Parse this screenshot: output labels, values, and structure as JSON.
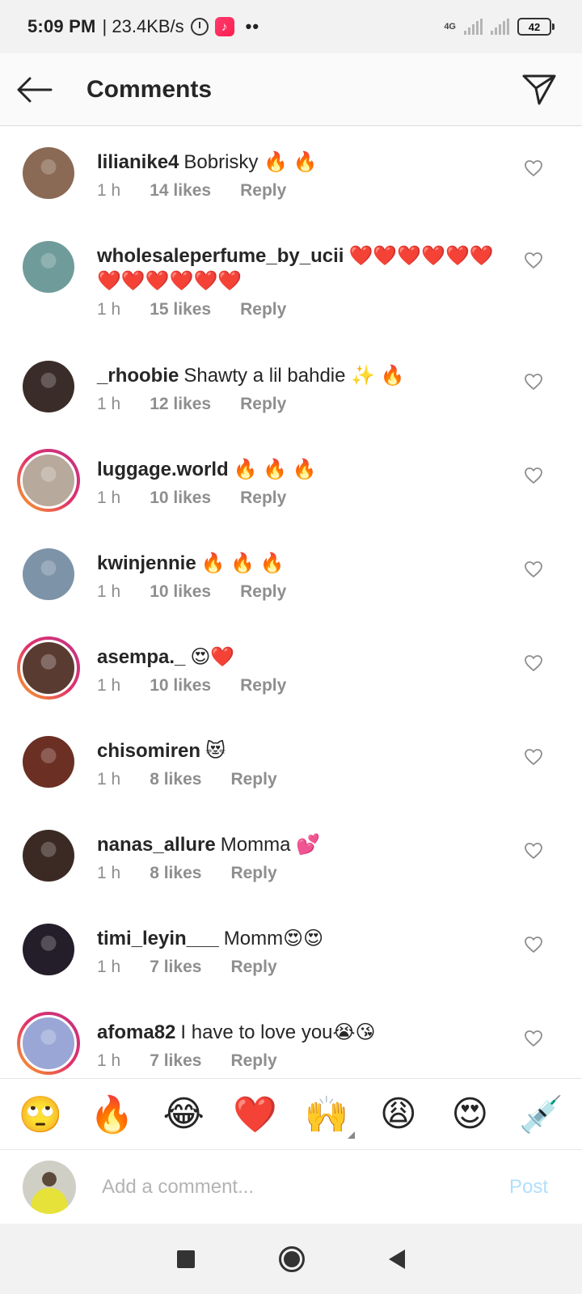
{
  "status_bar": {
    "time": "5:09 PM",
    "speed": "| 23.4KB/s",
    "dots": "••",
    "network": "4G",
    "battery": "42"
  },
  "header": {
    "title": "Comments"
  },
  "comments": [
    {
      "username": "lilianike4",
      "text": "Bobrisky 🔥 🔥",
      "time": "1 h",
      "likes": "14 likes",
      "reply": "Reply",
      "avatar_color": "#8a6a55",
      "story": false
    },
    {
      "username": "wholesaleperfume_by_ucii",
      "text": "❤️❤️❤️❤️❤️❤️❤️❤️❤️❤️❤️❤️",
      "time": "1 h",
      "likes": "15 likes",
      "reply": "Reply",
      "avatar_color": "#6f9c9a",
      "story": false
    },
    {
      "username": "_rhoobie",
      "text": "Shawty a lil bahdie ✨ 🔥",
      "time": "1 h",
      "likes": "12 likes",
      "reply": "Reply",
      "avatar_color": "#3a2c28",
      "story": false
    },
    {
      "username": "luggage.world",
      "text": "🔥 🔥 🔥",
      "time": "1 h",
      "likes": "10 likes",
      "reply": "Reply",
      "avatar_color": "#b7a99b",
      "story": true
    },
    {
      "username": "kwinjennie",
      "text": "🔥 🔥 🔥",
      "time": "1 h",
      "likes": "10 likes",
      "reply": "Reply",
      "avatar_color": "#7d93a8",
      "story": false
    },
    {
      "username": "asempa._",
      "text": "😍❤️",
      "time": "1 h",
      "likes": "10 likes",
      "reply": "Reply",
      "avatar_color": "#5a3b32",
      "story": true
    },
    {
      "username": "chisomiren",
      "text": "😻",
      "time": "1 h",
      "likes": "8 likes",
      "reply": "Reply",
      "avatar_color": "#6b2f24",
      "story": false
    },
    {
      "username": "nanas_allure",
      "text": "Momma 💕",
      "time": "1 h",
      "likes": "8 likes",
      "reply": "Reply",
      "avatar_color": "#3b2a24",
      "story": false
    },
    {
      "username": "timi_leyin___",
      "text": "Momm😍😍",
      "time": "1 h",
      "likes": "7 likes",
      "reply": "Reply",
      "avatar_color": "#241d2a",
      "story": false
    },
    {
      "username": "afoma82",
      "text": "I have to love you😭😘",
      "time": "1 h",
      "likes": "7 likes",
      "reply": "Reply",
      "avatar_color": "#9aa7d6",
      "story": true
    }
  ],
  "emoji_bar": [
    "🙄",
    "🔥",
    "😂",
    "❤️",
    "🙌",
    "😩",
    "😍",
    "💉"
  ],
  "comment_input": {
    "placeholder": "Add a comment...",
    "post_label": "Post"
  },
  "icons": {
    "back": "arrow-left-icon",
    "send": "paper-plane-icon",
    "like": "heart-outline-icon",
    "alarm": "alarm-icon",
    "app": "tiktok-icon"
  },
  "colors": {
    "story_ring_start": "#f9a825",
    "story_ring_end": "#c13584",
    "post_disabled": "#b2dffc",
    "meta_text": "#8e8e8e"
  }
}
